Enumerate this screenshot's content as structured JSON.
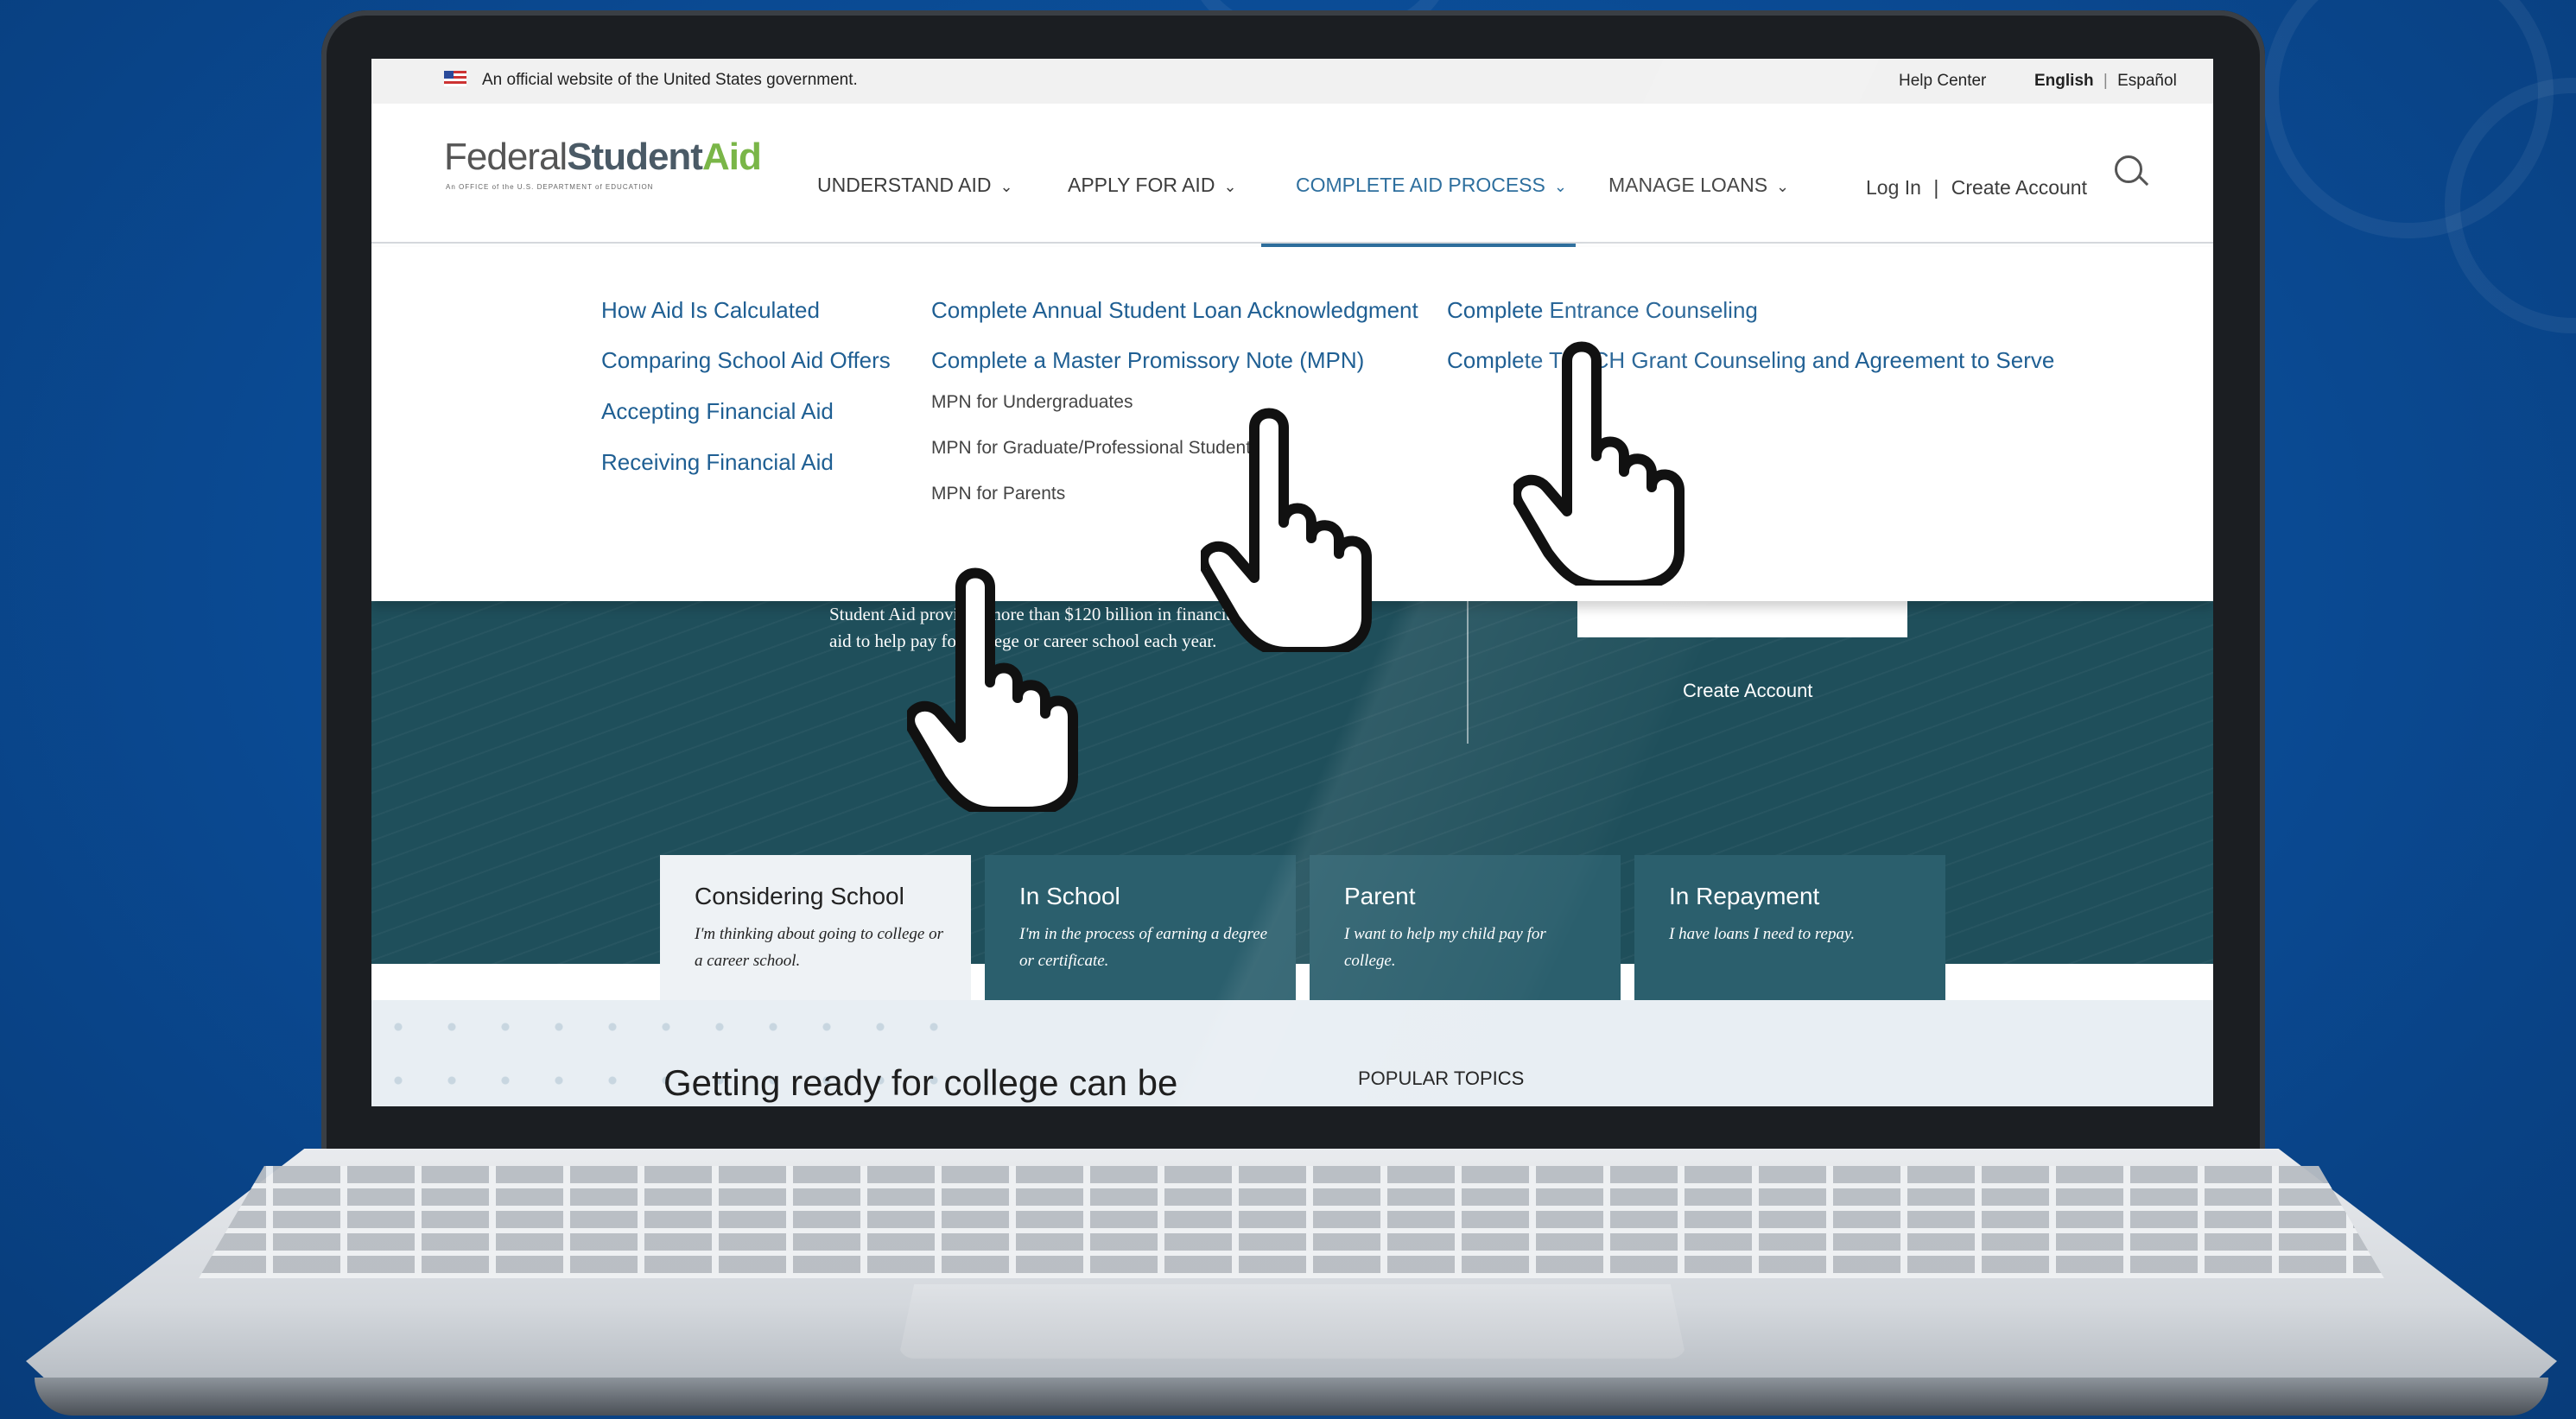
{
  "gov_banner": {
    "text": "An official website of the United States government.",
    "help_center": "Help Center",
    "lang_english": "English",
    "lang_separator": "|",
    "lang_spanish": "Español"
  },
  "header": {
    "logo_federal": "Federal",
    "logo_student": "Student",
    "logo_aid": "Aid",
    "logo_subtitle": "An OFFICE of the U.S. DEPARTMENT of EDUCATION",
    "nav": [
      {
        "label": "UNDERSTAND AID"
      },
      {
        "label": "APPLY FOR AID"
      },
      {
        "label": "COMPLETE AID PROCESS"
      },
      {
        "label": "MANAGE LOANS"
      }
    ],
    "login": "Log In",
    "auth_separator": "|",
    "create_account": "Create Account"
  },
  "dropdown": {
    "col1": [
      "How Aid Is Calculated",
      "Comparing School Aid Offers",
      "Accepting Financial Aid",
      "Receiving Financial Aid"
    ],
    "col2_main": [
      "Complete Annual Student Loan Acknowledgment",
      "Complete a Master Promissory Note (MPN)"
    ],
    "col2_sub": [
      "MPN for Undergraduates",
      "MPN for Graduate/Professional Students",
      "MPN for Parents"
    ],
    "col3": [
      "Complete Entrance Counseling",
      "Complete TEACH Grant Counseling and Agreement to Serve"
    ]
  },
  "hero": {
    "text_line1": "Student Aid provides more than $120 billion in financial",
    "text_line2": "aid to help pay for college or career school each year.",
    "create_account": "Create Account"
  },
  "tabs": [
    {
      "title": "Considering School",
      "desc": "I'm thinking about going to college or a career school."
    },
    {
      "title": "In School",
      "desc": "I'm in the process of earning a degree or certificate."
    },
    {
      "title": "Parent",
      "desc": "I want to help my child pay for college."
    },
    {
      "title": "In Repayment",
      "desc": "I have loans I need to repay."
    }
  ],
  "lower": {
    "heading": "Getting ready for college can be",
    "popular_topics": "POPULAR TOPICS"
  },
  "colors": {
    "background": "#0a4a93",
    "link": "#1f5f93",
    "hero": "#1f4f5b",
    "tab": "#2b5f6d",
    "brand_green": "#7ab648"
  },
  "icons": [
    "hand-pointer-icon",
    "search-icon",
    "chevron-down-icon",
    "us-flag-icon"
  ]
}
